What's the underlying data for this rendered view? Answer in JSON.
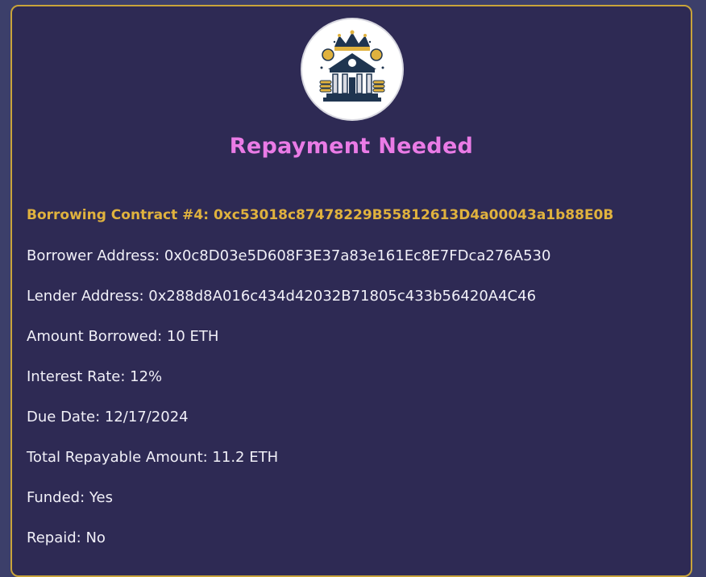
{
  "header": {
    "logo_icon": "bank-crown-logo-icon",
    "title": "Repayment Needed"
  },
  "contract": {
    "heading": "Borrowing Contract #4: 0xc53018c87478229B55812613D4a00043a1b88E0B",
    "fields": [
      "Borrower Address: 0x0c8D03e5D608F3E37a83e161Ec8E7FDca276A530",
      "Lender Address: 0x288d8A016c434d42032B71805c433b56420A4C46",
      "Amount Borrowed: 10 ETH",
      "Interest Rate: 12%",
      "Due Date: 12/17/2024",
      "Total Repayable Amount: 11.2 ETH",
      "Funded: Yes",
      "Repaid: No"
    ]
  },
  "colors": {
    "page_bg": "#3c3f6a",
    "card_bg": "#2e2a54",
    "card_border": "#c9a43a",
    "title": "#ea7be6",
    "heading": "#e0b23e",
    "text": "#f1f0f8"
  }
}
